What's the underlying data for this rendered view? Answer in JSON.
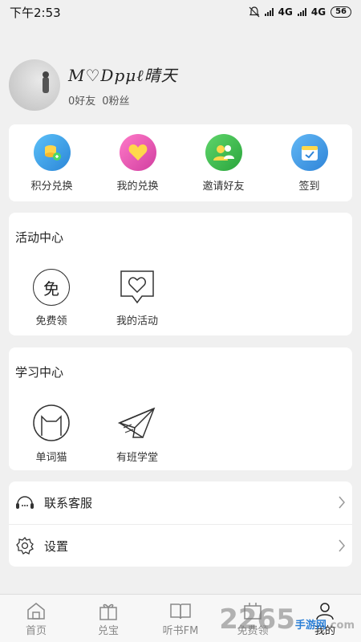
{
  "status": {
    "time": "下午2:53",
    "net1": "4G",
    "net2": "4G",
    "battery": "56"
  },
  "profile": {
    "nickname": "M♡Dpμℓ晴天",
    "friends": "0好友",
    "fans": "0粉丝"
  },
  "quick": [
    {
      "label": "积分兑换",
      "icon": "coins-exchange-icon",
      "color": "#3aa0e8"
    },
    {
      "label": "我的兑换",
      "icon": "heart-icon",
      "color": "#ee55b0"
    },
    {
      "label": "邀请好友",
      "icon": "users-icon",
      "color": "#3cbb4a"
    },
    {
      "label": "签到",
      "icon": "calendar-check-icon",
      "color": "#3a9be6"
    }
  ],
  "activity": {
    "title": "活动中心",
    "items": [
      {
        "label": "免费领",
        "glyph": "免"
      },
      {
        "label": "我的活动"
      }
    ]
  },
  "study": {
    "title": "学习中心",
    "items": [
      {
        "label": "单词猫"
      },
      {
        "label": "有班学堂"
      }
    ]
  },
  "list": [
    {
      "label": "联系客服",
      "icon": "customer-service-icon"
    },
    {
      "label": "设置",
      "icon": "gear-icon"
    }
  ],
  "tabs": [
    {
      "label": "首页",
      "icon": "home-icon"
    },
    {
      "label": "兑宝",
      "icon": "gift-icon"
    },
    {
      "label": "听书FM",
      "icon": "book-icon"
    },
    {
      "label": "免费领",
      "icon": "free-icon"
    },
    {
      "label": "我的",
      "icon": "user-icon",
      "active": true
    }
  ],
  "watermark": {
    "main": "2265",
    "sub": "手游网",
    "domain": ".com"
  }
}
